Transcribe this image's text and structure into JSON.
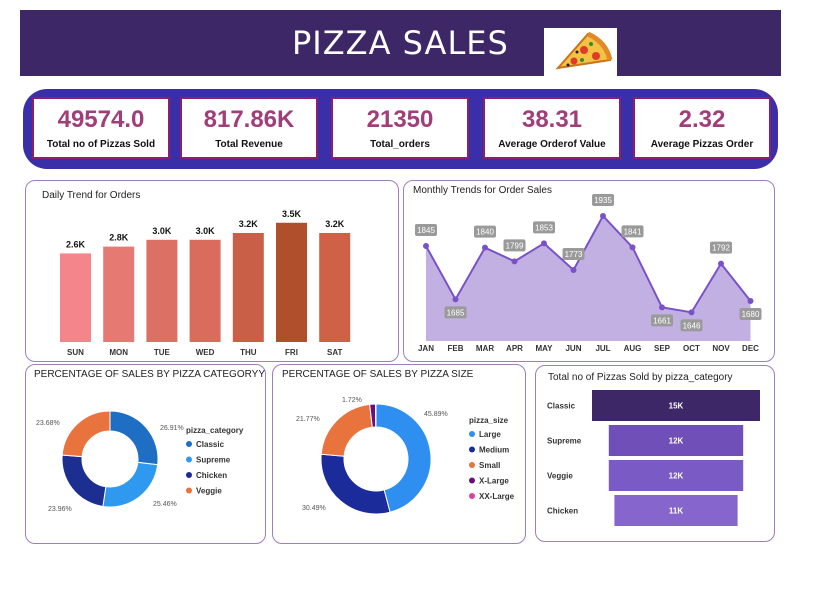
{
  "header": {
    "title": "PIZZA SALES",
    "logo_icon": "pizza-slice-icon"
  },
  "kpis": [
    {
      "value": "49574.0",
      "label": "Total no of Pizzas Sold"
    },
    {
      "value": "817.86K",
      "label": "Total Revenue"
    },
    {
      "value": "21350",
      "label": "Total_orders"
    },
    {
      "value": "38.31",
      "label": "Average Orderof Value"
    },
    {
      "value": "2.32",
      "label": "Average Pizzas Order"
    }
  ],
  "colors": {
    "header": "#3d2767",
    "kpi_band": "#3a2fa8",
    "kpi_value": "#a13d78"
  },
  "chart_data": [
    {
      "id": "daily",
      "type": "bar",
      "title": "Daily Trend for Orders",
      "categories": [
        "SUN",
        "MON",
        "TUE",
        "WED",
        "THU",
        "FRI",
        "SAT"
      ],
      "values": [
        2.6,
        2.8,
        3.0,
        3.0,
        3.2,
        3.5,
        3.2
      ],
      "data_labels": [
        "2.6K",
        "2.8K",
        "3.0K",
        "3.0K",
        "3.2K",
        "3.5K",
        "3.2K"
      ],
      "colors": [
        "#f4858a",
        "#e67a72",
        "#dd7064",
        "#d96c5c",
        "#c95f47",
        "#b04f2c",
        "#cf6246"
      ],
      "ylim": [
        0,
        3.9
      ]
    },
    {
      "id": "monthly",
      "type": "area",
      "title": "Monthly Trends for Order Sales",
      "categories": [
        "JAN",
        "FEB",
        "MAR",
        "APR",
        "MAY",
        "JUN",
        "JUL",
        "AUG",
        "SEP",
        "OCT",
        "NOV",
        "DEC"
      ],
      "values": [
        1845,
        1685,
        1840,
        1799,
        1853,
        1773,
        1935,
        1841,
        1661,
        1646,
        1792,
        1680
      ],
      "ylim": [
        1560,
        1950
      ],
      "color": "#7a52c7",
      "fill": "#c3b0e3"
    },
    {
      "id": "category",
      "type": "pie",
      "title": "PERCENTAGE OF SALES BY PIZZA CATEGORYY",
      "legend_title": "pizza_category",
      "labels": [
        "Classic",
        "Supreme",
        "Chicken",
        "Veggie"
      ],
      "values": [
        26.91,
        25.46,
        23.96,
        23.68
      ],
      "value_labels": [
        "26.91%",
        "25.46%",
        "23.96%",
        "23.68%"
      ],
      "colors": [
        "#1e6fc4",
        "#2e99ef",
        "#1c2e8f",
        "#e8733c"
      ]
    },
    {
      "id": "size",
      "type": "pie",
      "title": "PERCENTAGE OF SALES BY PIZZA SIZE",
      "legend_title": "pizza_size",
      "labels": [
        "Large",
        "Medium",
        "Small",
        "X-Large",
        "XX-Large"
      ],
      "values": [
        45.89,
        30.49,
        21.77,
        1.72,
        0.12
      ],
      "value_labels": [
        "45.89%",
        "30.49%",
        "21.77%",
        "1.72%",
        ""
      ],
      "colors": [
        "#2e8ff0",
        "#1c2b9a",
        "#e8733c",
        "#6a0f7a",
        "#e040a0"
      ]
    },
    {
      "id": "funnel",
      "type": "bar",
      "title": "Total no of Pizzas Sold by pizza_category",
      "categories": [
        "Classic",
        "Supreme",
        "Veggie",
        "Chicken"
      ],
      "values": [
        15,
        12,
        12,
        11
      ],
      "data_labels": [
        "15K",
        "12K",
        "12K",
        "11K"
      ],
      "colors": [
        "#3d2767",
        "#7050b8",
        "#7a5ac4",
        "#8666cc"
      ]
    }
  ]
}
